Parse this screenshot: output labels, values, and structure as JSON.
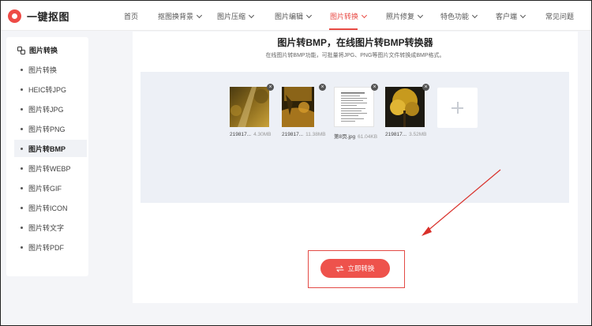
{
  "header": {
    "logo_text": "一键抠图",
    "nav": [
      {
        "label": "首页",
        "dropdown": false,
        "active": false
      },
      {
        "label": "抠图换背景",
        "dropdown": true,
        "active": false
      },
      {
        "label": "图片压缩",
        "dropdown": true,
        "active": false
      },
      {
        "label": "图片编辑",
        "dropdown": true,
        "active": false
      },
      {
        "label": "图片转换",
        "dropdown": true,
        "active": true
      },
      {
        "label": "照片修复",
        "dropdown": true,
        "active": false
      },
      {
        "label": "特色功能",
        "dropdown": true,
        "active": false
      },
      {
        "label": "客户端",
        "dropdown": true,
        "active": false
      },
      {
        "label": "常见问题",
        "dropdown": false,
        "active": false
      }
    ]
  },
  "sidebar": {
    "title": "图片转换",
    "items": [
      {
        "label": "图片转换",
        "active": false
      },
      {
        "label": "HEIC转JPG",
        "active": false
      },
      {
        "label": "图片转JPG",
        "active": false
      },
      {
        "label": "图片转PNG",
        "active": false
      },
      {
        "label": "图片转BMP",
        "active": true
      },
      {
        "label": "图片转WEBP",
        "active": false
      },
      {
        "label": "图片转GIF",
        "active": false
      },
      {
        "label": "图片转ICON",
        "active": false
      },
      {
        "label": "图片转文字",
        "active": false
      },
      {
        "label": "图片转PDF",
        "active": false
      }
    ]
  },
  "main": {
    "title": "图片转BMP，在线图片转BMP转换器",
    "subtitle": "在线图片转BMP功能，可批量将JPG、PNG等图片文件转换成BMP格式。",
    "files": [
      {
        "name": "219817...",
        "size": "4.30MB"
      },
      {
        "name": "219817...",
        "size": "11.38MB"
      },
      {
        "name": "第8页.jpg",
        "size": "61.04KB"
      },
      {
        "name": "219817...",
        "size": "3.52MB"
      }
    ],
    "convert_label": "立即转换"
  },
  "colors": {
    "accent": "#ee524c",
    "upload_bg": "#edf0f6"
  }
}
